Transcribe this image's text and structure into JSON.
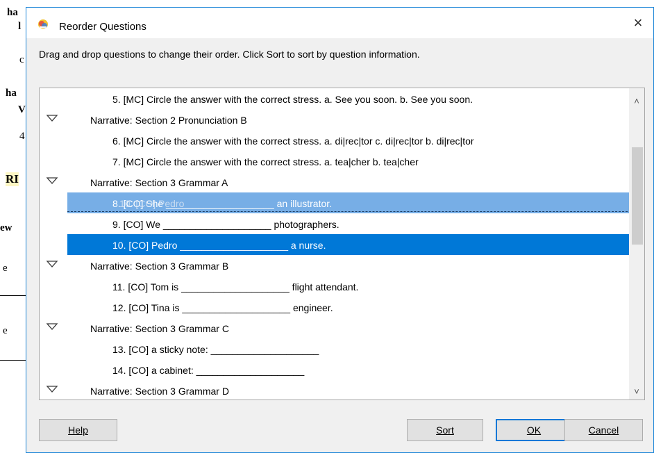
{
  "background_doc": {
    "fragments": [
      "ha",
      "l",
      "c",
      "ha",
      "V",
      "4",
      "RI",
      "ew",
      "e",
      "e"
    ]
  },
  "dialog": {
    "title": "Reorder Questions",
    "close_glyph": "×",
    "instructions": "Drag and drop questions to change their order. Click Sort to sort by question information.",
    "rows": [
      {
        "kind": "q",
        "text": "5. [MC] Circle the answer with the correct stress. a. See you soon. b. See you soon."
      },
      {
        "kind": "narr",
        "text": "Narrative: Section 2 Pronunciation B"
      },
      {
        "kind": "q",
        "text": "6. [MC] Circle the answer with the correct stress. a. di|rec|tor c. di|rec|tor  b. di|rec|tor"
      },
      {
        "kind": "q",
        "text": "7. [MC] Circle the answer with the correct stress. a. tea|cher b. tea|cher"
      },
      {
        "kind": "narr",
        "text": "Narrative: Section 3 Grammar A"
      },
      {
        "kind": "q",
        "text": "8. [CO] She ____________________ an illustrator."
      },
      {
        "kind": "q",
        "text": "9. [CO] We ____________________ photographers."
      },
      {
        "kind": "q",
        "text": "10. [CO] Pedro ____________________ a nurse."
      },
      {
        "kind": "narr",
        "text": "Narrative: Section 3 Grammar B"
      },
      {
        "kind": "q",
        "text": "11. [CO] Tom is ____________________ flight attendant."
      },
      {
        "kind": "q",
        "text": "12. [CO] Tina is ____________________ engineer."
      },
      {
        "kind": "narr",
        "text": "Narrative: Section 3 Grammar C"
      },
      {
        "kind": "q",
        "text": "13. [CO] a sticky note: ____________________"
      },
      {
        "kind": "q",
        "text": "14. [CO] a cabinet: ____________________"
      },
      {
        "kind": "narr",
        "text": "Narrative: Section 3 Grammar D"
      }
    ],
    "drag_ghost": "10. [CO] Pedro",
    "buttons": {
      "help": "Help",
      "sort": "Sort",
      "ok": "OK",
      "cancel": "Cancel"
    },
    "colors": {
      "selection": "#0078d7",
      "drag_highlight": "#77aee6",
      "border_accent": "#1883d7"
    }
  }
}
